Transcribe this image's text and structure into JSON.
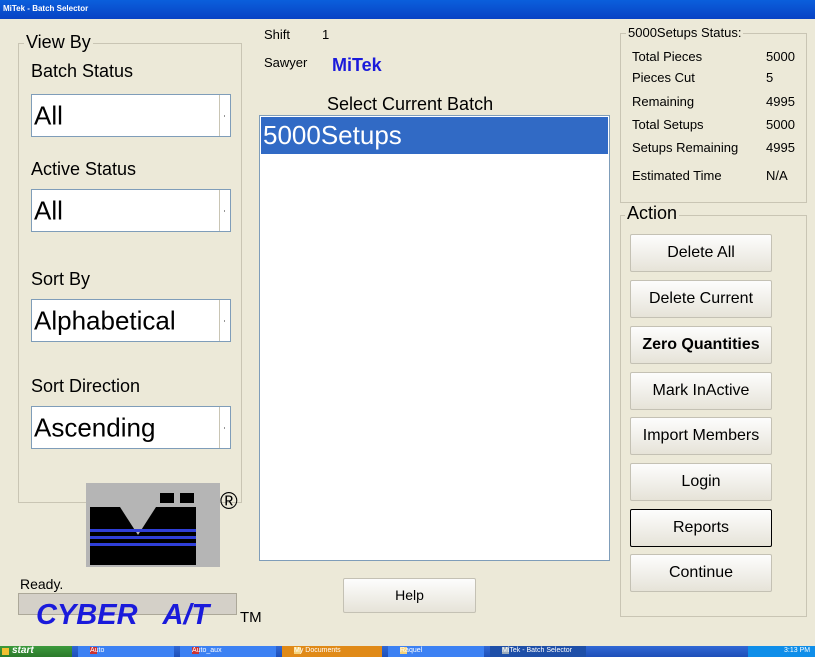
{
  "window": {
    "title": "MiTek - Batch Selector"
  },
  "shift": {
    "label": "Shift",
    "value": "1"
  },
  "sawyer": {
    "label": "Sawyer",
    "value": "MiTek"
  },
  "view_by": {
    "legend": "View By",
    "batch_status": {
      "label": "Batch Status",
      "value": "All"
    },
    "active_status": {
      "label": "Active Status",
      "value": "All"
    },
    "sort_by": {
      "label": "Sort By",
      "value": "Alphabetical"
    },
    "sort_direction": {
      "label": "Sort Direction",
      "value": "Ascending"
    }
  },
  "batch_list": {
    "heading": "Select Current Batch",
    "items": [
      {
        "label": "5000Setups",
        "selected": true
      }
    ]
  },
  "status": {
    "legend": "5000Setups Status:",
    "rows": [
      {
        "label": "Total Pieces",
        "value": "5000"
      },
      {
        "label": "Pieces Cut",
        "value": "5"
      },
      {
        "label": "Remaining",
        "value": "4995"
      },
      {
        "label": "Total Setups",
        "value": "5000"
      },
      {
        "label": "Setups Remaining",
        "value": "4995"
      },
      {
        "label": "Estimated Time",
        "value": "N/A"
      }
    ]
  },
  "action": {
    "legend": "Action",
    "buttons": [
      "Delete All",
      "Delete Current",
      "Zero Quantities",
      "Mark InActive",
      "Import Members",
      "Login",
      "Reports",
      "Continue"
    ]
  },
  "help_label": "Help",
  "status_bar": "Ready.",
  "brand": {
    "registered_mark": "®",
    "name": "CYBER A/T",
    "trademark": "TM",
    "text_color": "#1a1adb"
  },
  "taskbar": {
    "start": "start",
    "items": [
      "Auto",
      "Auto_aux",
      "My Documents",
      "Raquel",
      "MiTek - Batch Selector"
    ],
    "clock": "3:13 PM"
  },
  "colors": {
    "selection": "#316ac5",
    "face": "#ece9d8",
    "sawyer_text": "#1a1adb"
  }
}
